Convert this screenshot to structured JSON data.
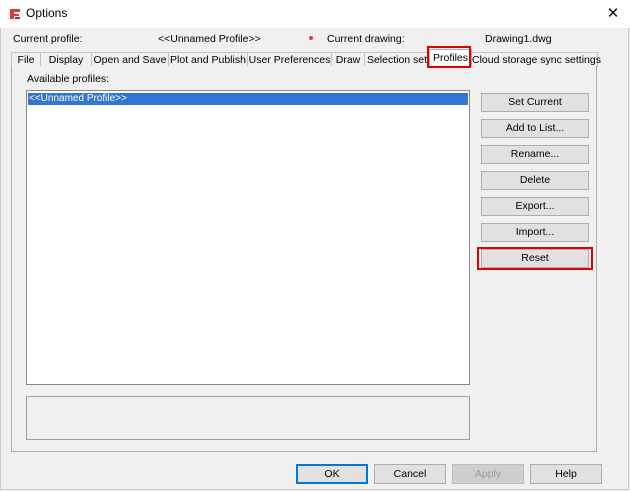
{
  "window": {
    "title": "Options",
    "close_glyph": "✕",
    "icon": "app-logo-icon",
    "accent": "#e1383b"
  },
  "info": {
    "profile_label": "Current profile:",
    "profile_value": "<<Unnamed Profile>>",
    "drawing_label": "Current drawing:",
    "drawing_value": "Drawing1.dwg"
  },
  "tabs": [
    {
      "label": "File"
    },
    {
      "label": "Display"
    },
    {
      "label": "Open and Save"
    },
    {
      "label": "Plot and Publish"
    },
    {
      "label": "User Preferences"
    },
    {
      "label": "Draw"
    },
    {
      "label": "Selection set"
    },
    {
      "label": "Profiles",
      "active": true
    },
    {
      "label": "Cloud storage sync settings"
    }
  ],
  "profiles": {
    "available_label": "Available profiles:",
    "items": [
      "<<Unnamed Profile>>"
    ],
    "selected": "<<Unnamed Profile>>"
  },
  "side_buttons": {
    "set_current": "Set Current",
    "add_to_list": "Add to List...",
    "rename": "Rename...",
    "delete": "Delete",
    "export": "Export...",
    "import": "Import...",
    "reset": "Reset"
  },
  "footer": {
    "ok": "OK",
    "cancel": "Cancel",
    "apply": "Apply",
    "help": "Help"
  },
  "colors": {
    "highlight_box": "#e00000",
    "selection": "#3474d4"
  }
}
